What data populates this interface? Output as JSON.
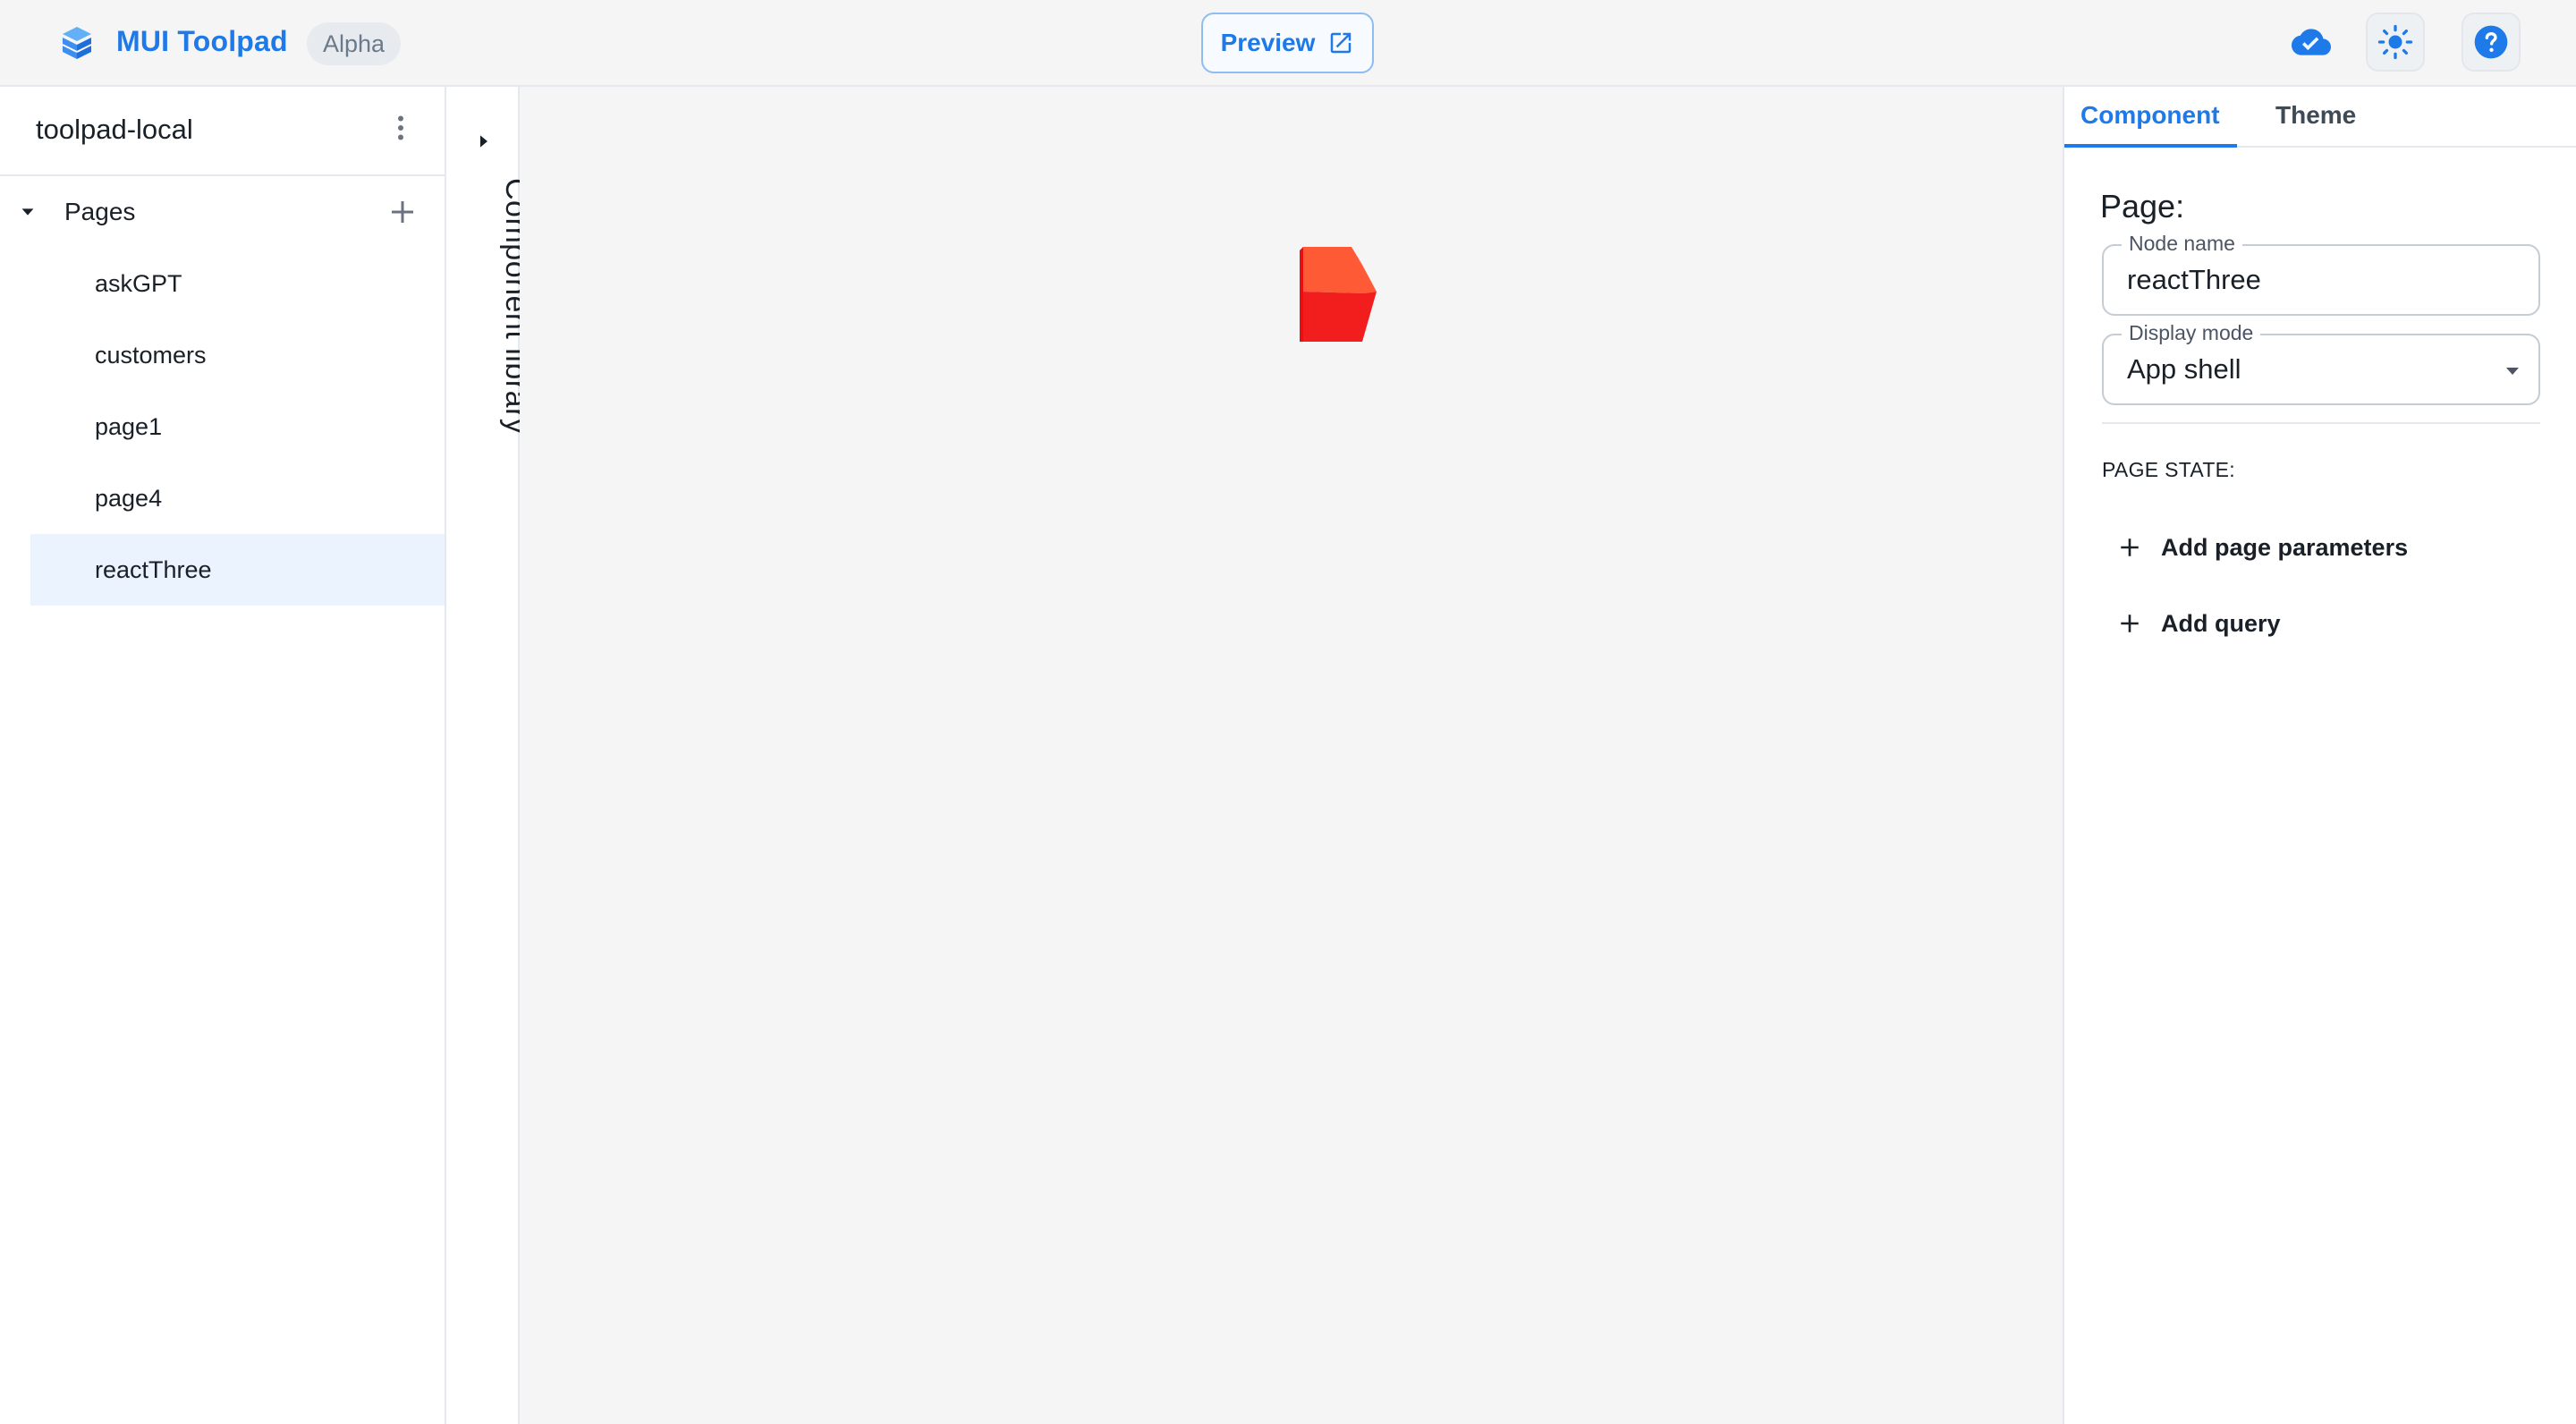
{
  "header": {
    "brand": "MUI Toolpad",
    "badge": "Alpha",
    "preview_label": "Preview",
    "icons": [
      "cloud-check-icon",
      "sun-icon",
      "help-icon"
    ],
    "accent": "#1e7ae8"
  },
  "sidebar": {
    "app_name": "toolpad-local",
    "section_label": "Pages",
    "pages": [
      "askGPT",
      "customers",
      "page1",
      "page4",
      "reactThree"
    ],
    "selected_page": "reactThree"
  },
  "rail": {
    "label": "Component library"
  },
  "inspector": {
    "tabs": [
      "Component",
      "Theme"
    ],
    "active_tab": "Component",
    "title": "Page:",
    "node_name": {
      "legend": "Node name",
      "value": "reactThree"
    },
    "display_mode": {
      "legend": "Display mode",
      "value": "App shell"
    },
    "page_state_label": "PAGE STATE:",
    "actions": [
      "Add page parameters",
      "Add query"
    ]
  },
  "canvas": {
    "cube_colors": [
      "#ff5a36",
      "#f21d1d",
      "#ea1010"
    ]
  }
}
